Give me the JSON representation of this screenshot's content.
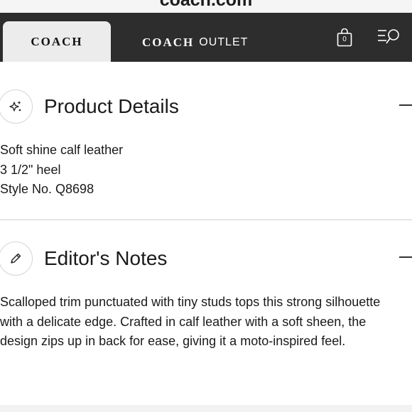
{
  "browser": {
    "url": "coach.com"
  },
  "nav": {
    "tabs": [
      {
        "label": "COACH"
      },
      {
        "label": "COACH",
        "suffix": "OUTLET"
      }
    ],
    "bag_count": "0",
    "icons": [
      "shopping-bag-icon",
      "menu-search-icon"
    ]
  },
  "sections": [
    {
      "title": "Product Details",
      "icon": "sparkle-icon",
      "expanded": true,
      "lines": [
        "Soft shine calf leather",
        "3 1/2\" heel",
        "Style No. Q8698"
      ]
    },
    {
      "title": "Editor's Notes",
      "icon": "pencil-icon",
      "expanded": true,
      "text": "Scalloped trim punctuated with tiny studs tops this strong silhouette with a delicate edge. Crafted in calf leather with a soft sheen, the design zips up in back for ease, giving it a moto-inspired feel."
    }
  ],
  "colors": {
    "nav_background": "#2d2d2d",
    "active_tab": "#ececec",
    "divider": "#cfcfcf"
  }
}
